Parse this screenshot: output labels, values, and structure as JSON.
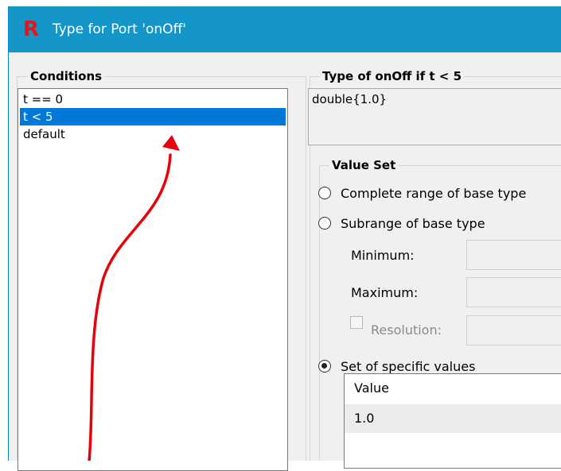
{
  "window": {
    "title": "Type for Port 'onOff'",
    "logo_letter": "R"
  },
  "conditions": {
    "label": "Conditions",
    "items": [
      "t == 0",
      "t < 5",
      "default"
    ],
    "selected_index": 1
  },
  "type_section": {
    "label": "Type of onOff if t < 5",
    "value": "double{1.0}"
  },
  "value_set": {
    "label": "Value Set",
    "options": [
      {
        "label": "Complete range of base type",
        "checked": false
      },
      {
        "label": "Subrange of base type",
        "checked": false
      },
      {
        "label": "Set of specific values",
        "checked": true
      }
    ],
    "minimum_label": "Minimum:",
    "maximum_label": "Maximum:",
    "resolution_label": "Resolution:"
  },
  "values_table": {
    "header": "Value",
    "rows": [
      "1.0"
    ]
  },
  "colors": {
    "titlebar": "#1596c9",
    "selection": "#0078d7",
    "annotation_arrow": "#e8000b"
  }
}
